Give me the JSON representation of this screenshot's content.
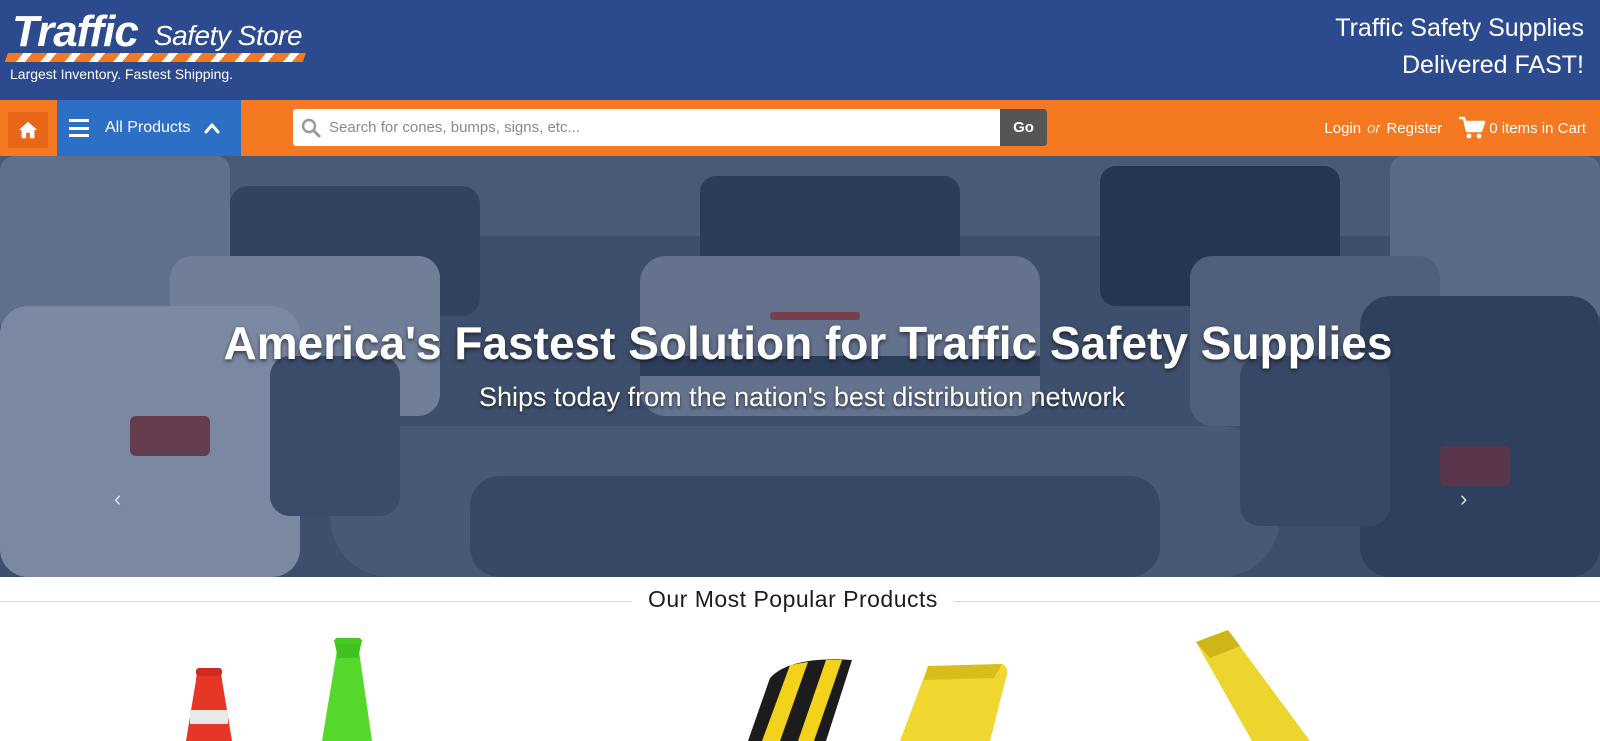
{
  "header": {
    "logo_main": "Traffic",
    "logo_secondary": "Safety Store",
    "tagline": "Largest Inventory. Fastest Shipping.",
    "promo_line1": "Traffic Safety Supplies",
    "promo_line2": "Delivered FAST!"
  },
  "nav": {
    "home_icon": "home-icon",
    "all_products_label": "All Products",
    "search_placeholder": "Search for cones, bumps, signs, etc...",
    "search_value": "",
    "go_label": "Go",
    "login_label": "Login",
    "or_label": "or",
    "register_label": "Register",
    "cart_label": "0 items in Cart"
  },
  "hero": {
    "title": "America's Fastest Solution for Traffic Safety Supplies",
    "subtitle": "Ships today from the nation's best distribution network",
    "prev_arrow": "‹",
    "next_arrow": "›"
  },
  "popular": {
    "title": "Our Most Popular Products"
  },
  "colors": {
    "header_blue": "#2c4b8f",
    "nav_orange": "#f47920",
    "all_products_blue": "#2c6fc4",
    "go_button": "#555555"
  }
}
